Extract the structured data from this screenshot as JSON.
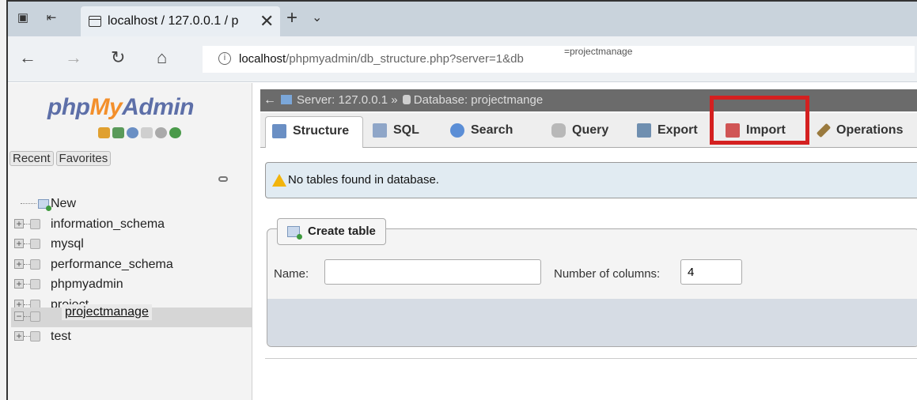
{
  "browser": {
    "tab_title": "localhost / 127.0.0.1 / p",
    "close_glyph": "✕",
    "new_tab_glyph": "+",
    "tab_menu_glyph": "⌄",
    "address_host": "localhost",
    "address_path": "/phpmyadmin/db_structure.php?server=1&db",
    "address_overlay": "=projectmanage"
  },
  "sidebar": {
    "logo_php": "php",
    "logo_my": "My",
    "logo_admin": "Admin",
    "recent_label": "Recent",
    "favorites_label": "Favorites",
    "tree": [
      {
        "label": "New"
      },
      {
        "label": "information_schema"
      },
      {
        "label": "mysql"
      },
      {
        "label": "performance_schema"
      },
      {
        "label": "phpmyadmin"
      },
      {
        "label": "project"
      },
      {
        "label": "projectmanage"
      },
      {
        "label": "test"
      }
    ]
  },
  "main": {
    "breadcrumb_server": "Server: 127.0.0.1",
    "breadcrumb_sep": " » ",
    "breadcrumb_db": "Database: projectmange",
    "tabs": [
      {
        "label": "Structure",
        "color": "#6a8fc4"
      },
      {
        "label": "SQL",
        "color": "#8fa6c8"
      },
      {
        "label": "Search",
        "color": "#5b8ed6"
      },
      {
        "label": "Query",
        "color": "#b8b8b8"
      },
      {
        "label": "Export",
        "color": "#6f8fb0"
      },
      {
        "label": "Import",
        "color": "#d05555"
      },
      {
        "label": "Operations",
        "color": "#9a7a3e"
      }
    ],
    "notice": "No tables found in database.",
    "create_table_label": "Create table",
    "name_label": "Name:",
    "name_value": "",
    "columns_label": "Number of columns:",
    "columns_value": "4"
  },
  "colors": {
    "highlight": "#d42020",
    "logo_blue": "#5d6fa8",
    "logo_orange": "#f38f2b"
  }
}
